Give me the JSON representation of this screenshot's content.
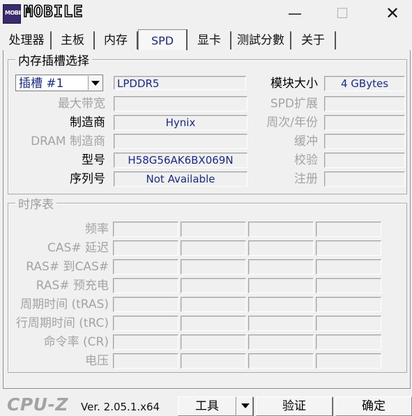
{
  "titlebar": {
    "logo_text": "MOBILE",
    "logo_badge": "MOBILE",
    "minimize_glyph": "—",
    "maximize_glyph": "☐",
    "close_glyph": "✕"
  },
  "tabs": [
    {
      "label": "处理器"
    },
    {
      "label": "主板"
    },
    {
      "label": "内存"
    },
    {
      "label": "SPD",
      "active": true
    },
    {
      "label": "显卡"
    },
    {
      "label": "测試分數"
    },
    {
      "label": "关于"
    }
  ],
  "slot_group": {
    "title": "内存插槽选择",
    "slot_select": "插槽 #1",
    "memory_type": "LPDDR5",
    "rows": [
      {
        "label": "最大带宽",
        "value": ""
      },
      {
        "label": "制造商",
        "value": "Hynix"
      },
      {
        "label": "DRAM 制造商",
        "value": ""
      },
      {
        "label": "型号",
        "value": "H58G56AK6BX069N"
      },
      {
        "label": "序列号",
        "value": "Not Available"
      }
    ],
    "right_rows": [
      {
        "label": "模块大小",
        "value": "4 GBytes"
      },
      {
        "label": "SPD扩展",
        "value": ""
      },
      {
        "label": "周次/年份",
        "value": ""
      },
      {
        "label": "缓冲",
        "value": ""
      },
      {
        "label": "校验",
        "value": ""
      },
      {
        "label": "注册",
        "value": ""
      }
    ]
  },
  "timing_group": {
    "title": "时序表",
    "rows": [
      {
        "label": "频率"
      },
      {
        "label": "CAS# 延迟"
      },
      {
        "label": "RAS# 到CAS#"
      },
      {
        "label": "RAS# 预充电"
      },
      {
        "label": "周期时间 (tRAS)"
      },
      {
        "label": "行周期时间 (tRC)"
      },
      {
        "label": "命令率 (CR)"
      },
      {
        "label": "电压"
      }
    ]
  },
  "footer": {
    "brand": "CPU-Z",
    "version": "Ver. 2.05.1.x64",
    "tools_label": "工具",
    "validate_label": "验证",
    "ok_label": "确定"
  },
  "colors": {
    "value_text": "#1a2a86",
    "disabled_text": "#a3a3a3"
  }
}
